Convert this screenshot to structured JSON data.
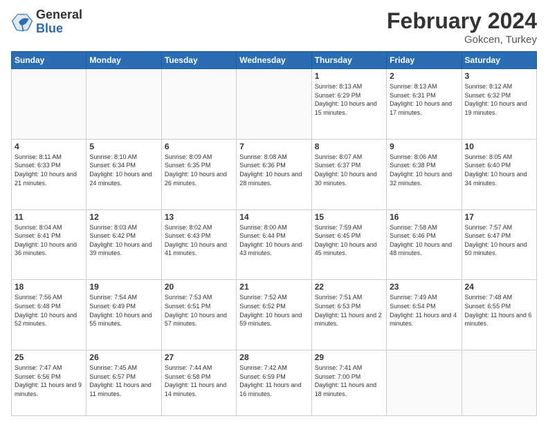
{
  "logo": {
    "general": "General",
    "blue": "Blue"
  },
  "title": {
    "month": "February 2024",
    "location": "Gokcen, Turkey"
  },
  "weekdays": [
    "Sunday",
    "Monday",
    "Tuesday",
    "Wednesday",
    "Thursday",
    "Friday",
    "Saturday"
  ],
  "weeks": [
    [
      {
        "day": "",
        "info": ""
      },
      {
        "day": "",
        "info": ""
      },
      {
        "day": "",
        "info": ""
      },
      {
        "day": "",
        "info": ""
      },
      {
        "day": "1",
        "info": "Sunrise: 8:13 AM\nSunset: 6:29 PM\nDaylight: 10 hours and 15 minutes."
      },
      {
        "day": "2",
        "info": "Sunrise: 8:13 AM\nSunset: 6:31 PM\nDaylight: 10 hours and 17 minutes."
      },
      {
        "day": "3",
        "info": "Sunrise: 8:12 AM\nSunset: 6:32 PM\nDaylight: 10 hours and 19 minutes."
      }
    ],
    [
      {
        "day": "4",
        "info": "Sunrise: 8:11 AM\nSunset: 6:33 PM\nDaylight: 10 hours and 21 minutes."
      },
      {
        "day": "5",
        "info": "Sunrise: 8:10 AM\nSunset: 6:34 PM\nDaylight: 10 hours and 24 minutes."
      },
      {
        "day": "6",
        "info": "Sunrise: 8:09 AM\nSunset: 6:35 PM\nDaylight: 10 hours and 26 minutes."
      },
      {
        "day": "7",
        "info": "Sunrise: 8:08 AM\nSunset: 6:36 PM\nDaylight: 10 hours and 28 minutes."
      },
      {
        "day": "8",
        "info": "Sunrise: 8:07 AM\nSunset: 6:37 PM\nDaylight: 10 hours and 30 minutes."
      },
      {
        "day": "9",
        "info": "Sunrise: 8:06 AM\nSunset: 6:38 PM\nDaylight: 10 hours and 32 minutes."
      },
      {
        "day": "10",
        "info": "Sunrise: 8:05 AM\nSunset: 6:40 PM\nDaylight: 10 hours and 34 minutes."
      }
    ],
    [
      {
        "day": "11",
        "info": "Sunrise: 8:04 AM\nSunset: 6:41 PM\nDaylight: 10 hours and 36 minutes."
      },
      {
        "day": "12",
        "info": "Sunrise: 8:03 AM\nSunset: 6:42 PM\nDaylight: 10 hours and 39 minutes."
      },
      {
        "day": "13",
        "info": "Sunrise: 8:02 AM\nSunset: 6:43 PM\nDaylight: 10 hours and 41 minutes."
      },
      {
        "day": "14",
        "info": "Sunrise: 8:00 AM\nSunset: 6:44 PM\nDaylight: 10 hours and 43 minutes."
      },
      {
        "day": "15",
        "info": "Sunrise: 7:59 AM\nSunset: 6:45 PM\nDaylight: 10 hours and 45 minutes."
      },
      {
        "day": "16",
        "info": "Sunrise: 7:58 AM\nSunset: 6:46 PM\nDaylight: 10 hours and 48 minutes."
      },
      {
        "day": "17",
        "info": "Sunrise: 7:57 AM\nSunset: 6:47 PM\nDaylight: 10 hours and 50 minutes."
      }
    ],
    [
      {
        "day": "18",
        "info": "Sunrise: 7:56 AM\nSunset: 6:48 PM\nDaylight: 10 hours and 52 minutes."
      },
      {
        "day": "19",
        "info": "Sunrise: 7:54 AM\nSunset: 6:49 PM\nDaylight: 10 hours and 55 minutes."
      },
      {
        "day": "20",
        "info": "Sunrise: 7:53 AM\nSunset: 6:51 PM\nDaylight: 10 hours and 57 minutes."
      },
      {
        "day": "21",
        "info": "Sunrise: 7:52 AM\nSunset: 6:52 PM\nDaylight: 10 hours and 59 minutes."
      },
      {
        "day": "22",
        "info": "Sunrise: 7:51 AM\nSunset: 6:53 PM\nDaylight: 11 hours and 2 minutes."
      },
      {
        "day": "23",
        "info": "Sunrise: 7:49 AM\nSunset: 6:54 PM\nDaylight: 11 hours and 4 minutes."
      },
      {
        "day": "24",
        "info": "Sunrise: 7:48 AM\nSunset: 6:55 PM\nDaylight: 11 hours and 6 minutes."
      }
    ],
    [
      {
        "day": "25",
        "info": "Sunrise: 7:47 AM\nSunset: 6:56 PM\nDaylight: 11 hours and 9 minutes."
      },
      {
        "day": "26",
        "info": "Sunrise: 7:45 AM\nSunset: 6:57 PM\nDaylight: 11 hours and 11 minutes."
      },
      {
        "day": "27",
        "info": "Sunrise: 7:44 AM\nSunset: 6:58 PM\nDaylight: 11 hours and 14 minutes."
      },
      {
        "day": "28",
        "info": "Sunrise: 7:42 AM\nSunset: 6:59 PM\nDaylight: 11 hours and 16 minutes."
      },
      {
        "day": "29",
        "info": "Sunrise: 7:41 AM\nSunset: 7:00 PM\nDaylight: 11 hours and 18 minutes."
      },
      {
        "day": "",
        "info": ""
      },
      {
        "day": "",
        "info": ""
      }
    ]
  ]
}
